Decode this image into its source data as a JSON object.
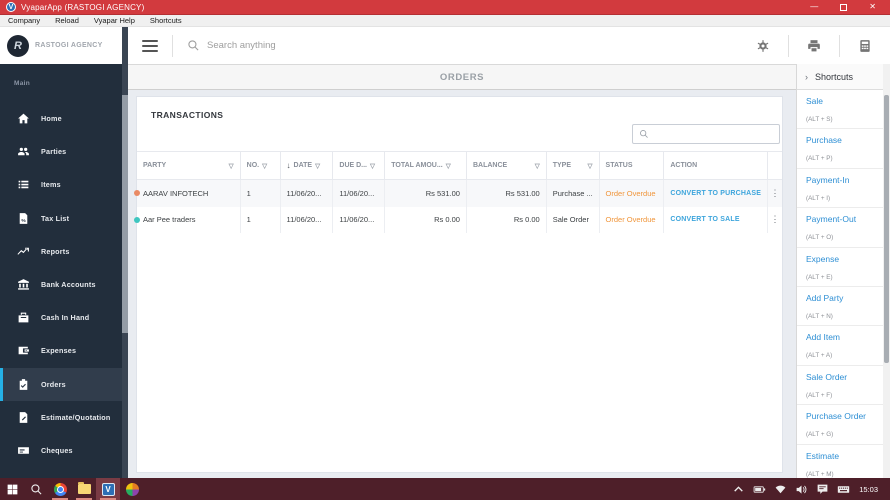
{
  "titlebar": {
    "title": "VyaparApp (RASTOGI AGENCY)",
    "minimize": "—",
    "close": "✕",
    "badge": "V"
  },
  "menubar": {
    "items": [
      "Company",
      "Reload",
      "Vyapar Help",
      "Shortcuts"
    ]
  },
  "topbar": {
    "search_placeholder": "Search anything"
  },
  "sidebar": {
    "company": "RASTOGI AGENCY",
    "section": "Main",
    "items": [
      {
        "label": "Home",
        "icon": "home-icon"
      },
      {
        "label": "Parties",
        "icon": "people-icon"
      },
      {
        "label": "Items",
        "icon": "list-icon"
      },
      {
        "label": "Tax List",
        "icon": "tax-document-icon"
      },
      {
        "label": "Reports",
        "icon": "trend-chart-icon"
      },
      {
        "label": "Bank Accounts",
        "icon": "bank-icon"
      },
      {
        "label": "Cash In Hand",
        "icon": "cash-box-icon"
      },
      {
        "label": "Expenses",
        "icon": "wallet-icon"
      },
      {
        "label": "Orders",
        "icon": "clipboard-check-icon",
        "active": true
      },
      {
        "label": "Estimate/Quotation",
        "icon": "estimate-document-icon"
      },
      {
        "label": "Cheques",
        "icon": "cheque-icon"
      }
    ]
  },
  "content": {
    "page_title": "ORDERS",
    "panel_title": "TRANSACTIONS",
    "table": {
      "columns": [
        "PARTY",
        "NO.",
        "DATE",
        "DUE D...",
        "TOTAL AMOU...",
        "BALANCE",
        "TYPE",
        "STATUS",
        "ACTION"
      ],
      "sort_arrow": "↓",
      "funnel": "▽",
      "kebab": "⋮",
      "rows": [
        {
          "party": "AARAV INFOTECH",
          "no": "1",
          "date": "11/06/20...",
          "due": "11/06/20...",
          "total": "Rs 531.00",
          "balance": "Rs 531.00",
          "type": "Purchase ...",
          "status": "Order Overdue",
          "action": "CONVERT TO PURCHASE"
        },
        {
          "party": "Aar Pee traders",
          "no": "1",
          "date": "11/06/20...",
          "due": "11/06/20...",
          "total": "Rs 0.00",
          "balance": "Rs 0.00",
          "type": "Sale Order",
          "status": "Order Overdue",
          "action": "CONVERT TO SALE"
        }
      ]
    }
  },
  "shortcuts": {
    "chevron": "›",
    "title": "Shortcuts",
    "items": [
      {
        "label": "Sale",
        "key": "(ALT + S)"
      },
      {
        "label": "Purchase",
        "key": "(ALT + P)"
      },
      {
        "label": "Payment-In",
        "key": "(ALT + I)"
      },
      {
        "label": "Payment-Out",
        "key": "(ALT + O)"
      },
      {
        "label": "Expense",
        "key": "(ALT + E)"
      },
      {
        "label": "Add Party",
        "key": "(ALT + N)"
      },
      {
        "label": "Add Item",
        "key": "(ALT + A)"
      },
      {
        "label": "Sale Order",
        "key": "(ALT + F)"
      },
      {
        "label": "Purchase Order",
        "key": "(ALT + G)"
      },
      {
        "label": "Estimate",
        "key": "(ALT + M)"
      }
    ]
  },
  "taskbar": {
    "time": "15:03",
    "vyapar_badge": "V"
  },
  "colors": {
    "titlebar_red": "#d23a3e",
    "sidebar_dark": "#222e3c",
    "active_accent_cyan": "#25b1e6",
    "link_blue": "#3da5dc",
    "status_orange": "#f0963c",
    "taskbar_maroon": "#4e1f29",
    "row_dot_orange": "#e98a64",
    "row_dot_teal": "#3ec6c0"
  }
}
